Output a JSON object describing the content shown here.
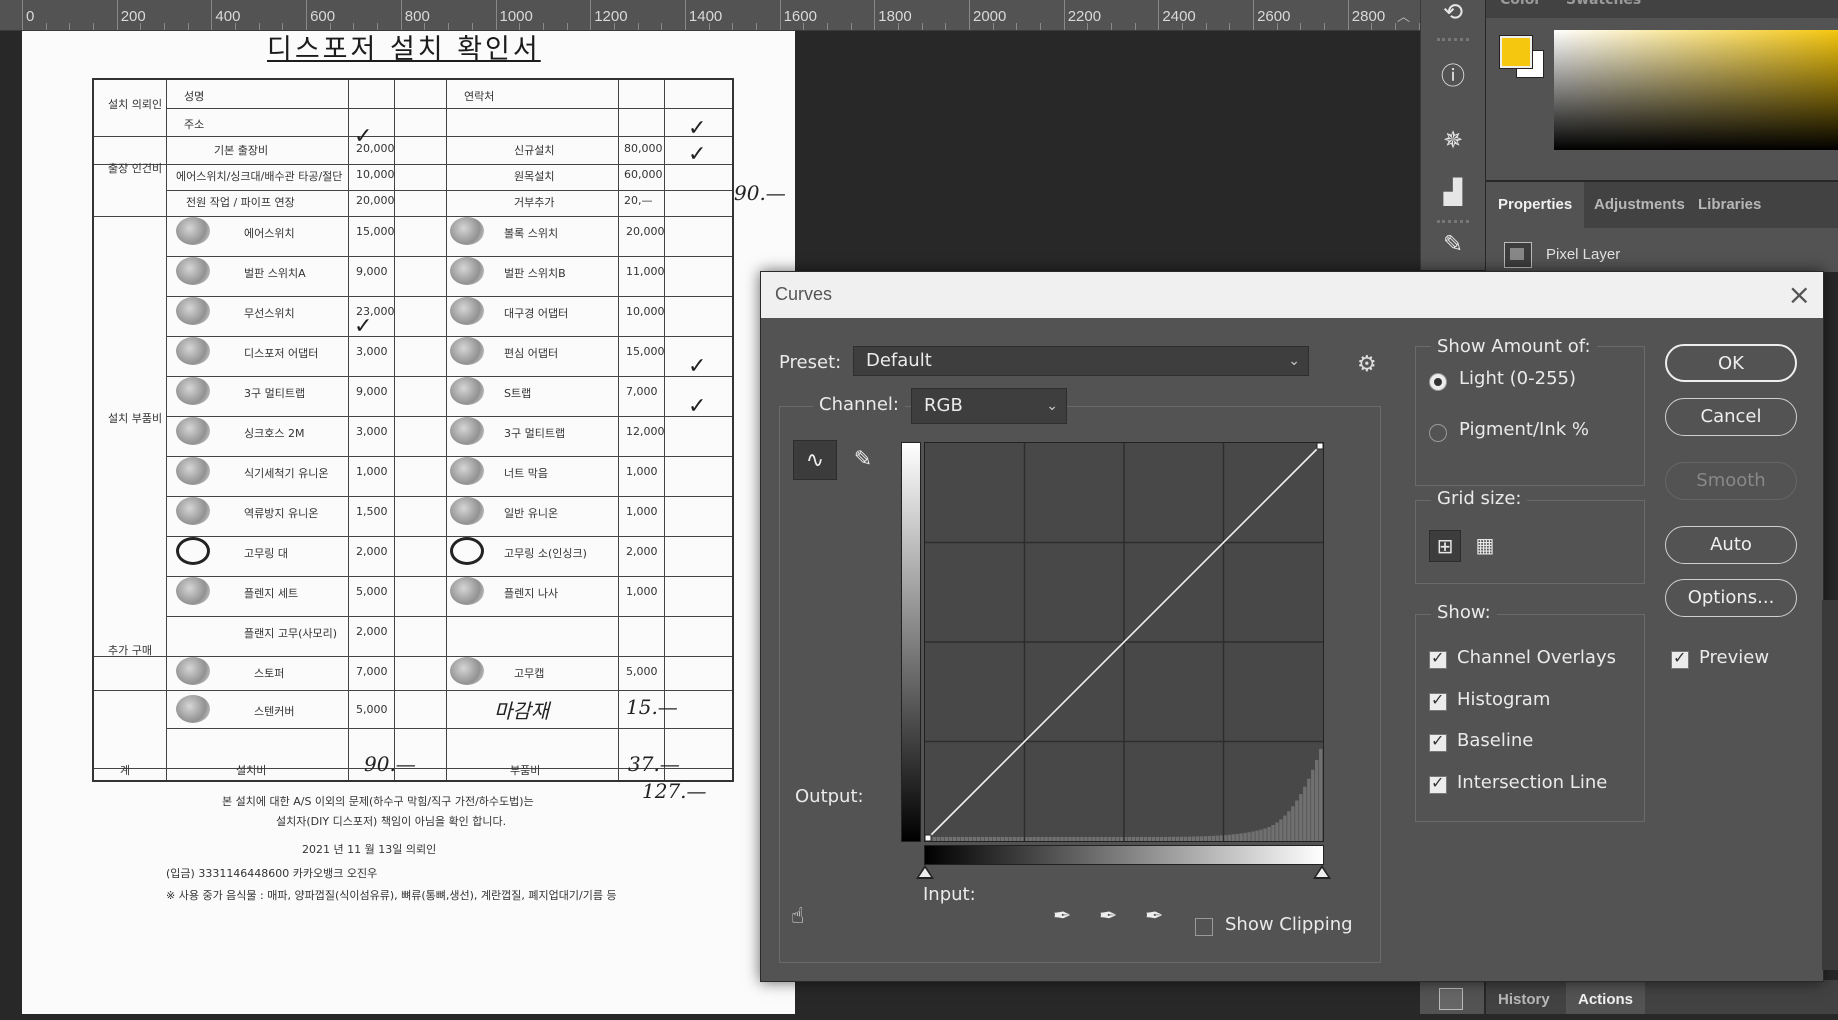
{
  "ruler": {
    "labels": [
      "0",
      "200",
      "400",
      "600",
      "800",
      "1000",
      "1200",
      "1400",
      "1600",
      "1800",
      "2000",
      "2200",
      "2400",
      "2600",
      "2800"
    ]
  },
  "document": {
    "title": "디스포저 설치 확인서",
    "rows": [
      {
        "label": "설치 의뢰인",
        "items": [
          "성명",
          "주소"
        ],
        "right": "연락처"
      },
      {
        "label": "출장 인건비",
        "items": [
          "기본 출장비",
          "에어스위치/싱크대/배수관 타공/절단",
          "전원 작업 / 파이프 연장"
        ],
        "prices": [
          "20,000",
          "10,000",
          "20,000"
        ],
        "right": [
          "신규설치",
          "원목설치",
          "거부추가"
        ],
        "rprices": [
          "80,000",
          "60,000",
          "20,—"
        ]
      },
      {
        "label": "설치 부품비",
        "items": [
          "에어스위치",
          "벌판 스위치A",
          "무선스위치",
          "디스포저 어댑터",
          "3구 멀티트랩",
          "싱크호스 2M",
          "식기세척기 유니온",
          "역류방지 유니온",
          "고무링 대",
          "플렌지 세트",
          "플랜지 고무(사모리)"
        ],
        "prices": [
          "15,000",
          "9,000",
          "23,000",
          "3,000",
          "9,000",
          "3,000",
          "1,000",
          "1,500",
          "2,000",
          "5,000",
          "2,000"
        ],
        "right": [
          "볼록 스위치",
          "벌판 스위치B",
          "대구경 어댑터",
          "편심 어댑터",
          "S트랩",
          "3구 멀티트랩",
          "너트 막음",
          "일반 유니온",
          "고무링 소(인싱크)",
          "플렌지 나사"
        ],
        "rprices": [
          "20,000",
          "11,000",
          "10,000",
          "15,000",
          "7,000",
          "12,000",
          "1,000",
          "1,000",
          "2,000",
          "1,000"
        ]
      },
      {
        "label": "추가 구매",
        "items": [
          "스토퍼",
          "스텐커버"
        ],
        "prices": [
          "7,000",
          "5,000"
        ],
        "right": [
          "고무캡",
          "마감재"
        ],
        "rprices": [
          "5,000",
          "15.—"
        ]
      },
      {
        "label": "계",
        "items": [
          "설치비"
        ],
        "prices": [
          "90.—"
        ],
        "right": [
          "부품비"
        ],
        "rprices": [
          "37.—"
        ]
      }
    ],
    "margin_note": "90.—",
    "total_note": "127.—",
    "footer": [
      "본 설치에 대한 A/S 이외의 문제(하수구 막힘/직구 가전/하수도법)는",
      "설치자(DIY 디스포저) 책임이 아님을 확인 합니다.",
      "2021 년 11 월 13일       의뢰인",
      "(입금) 3331146448600 카카오뱅크 오진우",
      "※ 사용 중가 음식물 : 매파, 양파껍질(식이섬유류), 뼈류(통뼈,생선), 계란껍질, 폐지업대기/기름 등"
    ]
  },
  "right_panels": {
    "color_tabs": [
      "Color",
      "Swatches"
    ],
    "foreground_color": "#f5c70f",
    "background_color": "#ffffff",
    "properties_tabs": [
      "Properties",
      "Adjustments",
      "Libraries"
    ],
    "properties_active": "Properties",
    "layer_type": "Pixel Layer",
    "bottom_tabs": [
      "History",
      "Actions"
    ],
    "bottom_active": "Actions",
    "tool_strip_icons": [
      "history-icon",
      "info-icon",
      "compass-icon",
      "histogram-icon",
      "brush-icon"
    ]
  },
  "curves": {
    "title": "Curves",
    "preset_label": "Preset:",
    "preset_value": "Default",
    "channel_label": "Channel:",
    "channel_value": "RGB",
    "output_label": "Output:",
    "input_label": "Input:",
    "show_clipping_label": "Show Clipping",
    "show_clipping": false,
    "show_amount": {
      "title": "Show Amount of:",
      "options": [
        {
          "label": "Light  (0-255)",
          "selected": true
        },
        {
          "label": "Pigment/Ink %",
          "selected": false
        }
      ]
    },
    "grid_size": {
      "title": "Grid size:",
      "selected": "simple"
    },
    "show": {
      "title": "Show:",
      "options": [
        {
          "label": "Channel Overlays",
          "checked": true
        },
        {
          "label": "Histogram",
          "checked": true
        },
        {
          "label": "Baseline",
          "checked": true
        },
        {
          "label": "Intersection Line",
          "checked": true
        }
      ]
    },
    "buttons": {
      "ok": "OK",
      "cancel": "Cancel",
      "smooth": "Smooth",
      "auto": "Auto",
      "options": "Options..."
    },
    "preview_label": "Preview",
    "preview_checked": true,
    "curve_points": [
      [
        0,
        0
      ],
      [
        255,
        255
      ]
    ]
  }
}
